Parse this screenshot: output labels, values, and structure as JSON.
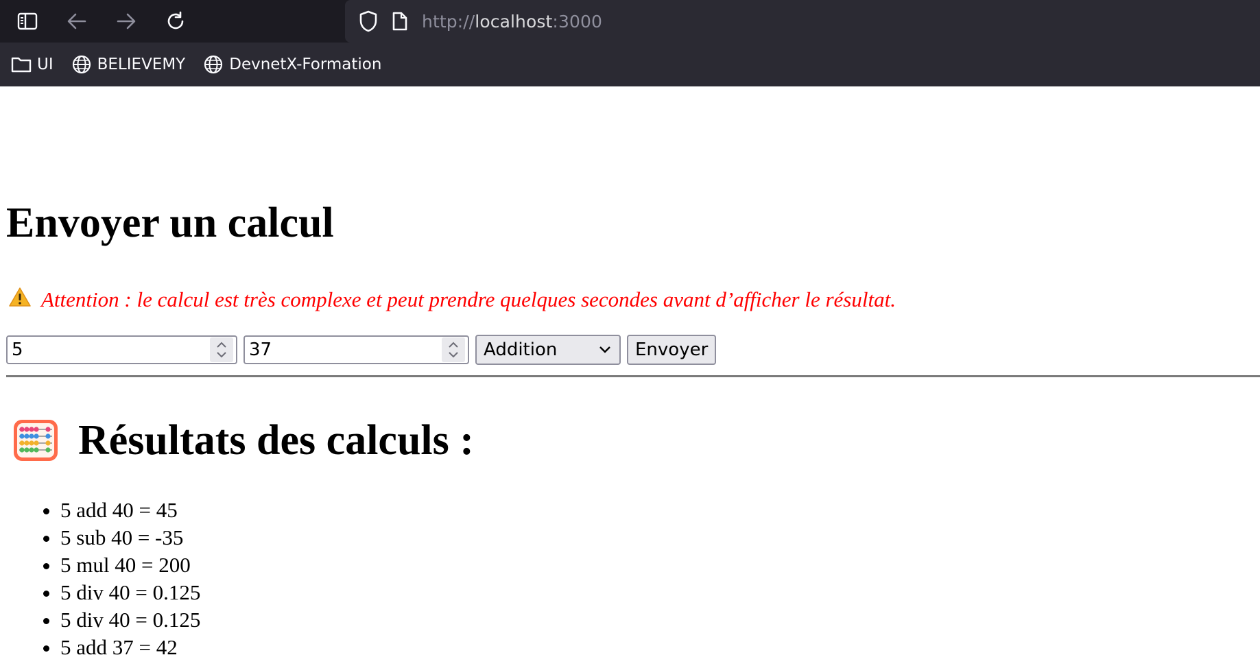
{
  "browser": {
    "url_scheme": "http://",
    "url_host": "localhost",
    "url_port": ":3000",
    "bookmarks": [
      {
        "label": "UI",
        "icon": "folder-icon"
      },
      {
        "label": "BELIEVEMY",
        "icon": "globe-icon"
      },
      {
        "label": "DevnetX-Formation",
        "icon": "globe-icon"
      }
    ]
  },
  "page": {
    "title": "Envoyer un calcul",
    "warning_icon": "⚠️",
    "warning_text": "Attention : le calcul est très complexe et peut prendre quelques secondes avant d’afficher le résultat.",
    "form": {
      "operand_a": "5",
      "operand_b": "37",
      "operation": "Addition",
      "submit_label": "Envoyer"
    },
    "results_title": "Résultats des calculs :",
    "results_icon": "abacus-icon",
    "results": [
      "5 add 40 = 45",
      "5 sub 40 = -35",
      "5 mul 40 = 200",
      "5 div 40 = 0.125",
      "5 div 40 = 0.125",
      "5 add 37 = 42"
    ]
  },
  "colors": {
    "warning": "#ff0000",
    "chrome_bg": "#1c1b22",
    "bookmarks_bg": "#2b2a33"
  }
}
